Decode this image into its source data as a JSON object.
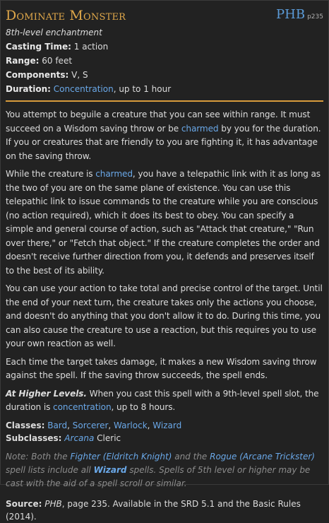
{
  "spell": {
    "name": "Dominate Monster",
    "source_abbr": "PHB",
    "source_page": "p235",
    "level_school": "8th-level enchantment"
  },
  "stats": {
    "casting_time_label": "Casting Time:",
    "casting_time": "1 action",
    "range_label": "Range:",
    "range": "60 feet",
    "components_label": "Components:",
    "components": "V, S",
    "duration_label": "Duration:",
    "duration_link": "Concentration",
    "duration_rest": ", up to 1 hour"
  },
  "body": {
    "p1_a": "You attempt to beguile a creature that you can see within range. It must succeed on a Wisdom saving throw or be ",
    "p1_link": "charmed",
    "p1_b": " by you for the duration. If you or creatures that are friendly to you are fighting it, it has advantage on the saving throw.",
    "p2_a": "While the creature is ",
    "p2_link": "charmed",
    "p2_b": ", you have a telepathic link with it as long as the two of you are on the same plane of existence. You can use this telepathic link to issue commands to the creature while you are conscious (no action required), which it does its best to obey. You can specify a simple and general course of action, such as \"Attack that creature,\" \"Run over there,\" or \"Fetch that object.\" If the creature completes the order and doesn't receive further direction from you, it defends and preserves itself to the best of its ability.",
    "p3": "You can use your action to take total and precise control of the target. Until the end of your next turn, the creature takes only the actions you choose, and doesn't do anything that you don't allow it to do. During this time, you can also cause the creature to use a reaction, but this requires you to use your own reaction as well.",
    "p4": "Each time the target takes damage, it makes a new Wisdom saving throw against the spell. If the saving throw succeeds, the spell ends.",
    "higher_label": "At Higher Levels.",
    "higher_a": " When you cast this spell with a 9th-level spell slot, the duration is ",
    "higher_link": "concentration",
    "higher_b": ", up to 8 hours."
  },
  "classes": {
    "label": "Classes:",
    "items": [
      "Bard",
      "Sorcerer",
      "Warlock",
      "Wizard"
    ],
    "sub_label": "Subclasses:",
    "sub_link": "Arcana",
    "sub_rest": " Cleric"
  },
  "note": {
    "a": "Note: Both the ",
    "fighter": "Fighter (Eldritch Knight)",
    "b": " and the ",
    "rogue": "Rogue (Arcane Trickster)",
    "c": " spell lists include all ",
    "wizard": "Wizard",
    "d": " spells. Spells of 5th level or higher may be cast with the aid of a spell scroll or similar."
  },
  "source": {
    "label": "Source:",
    "book": "PHB",
    "rest": ", page 235. Available in the SRD 5.1 and the Basic Rules (2014)."
  },
  "colors": {
    "title": "#e0a84a",
    "link": "#6aa8e8",
    "rule": "#d89c3c",
    "background": "#222222"
  }
}
